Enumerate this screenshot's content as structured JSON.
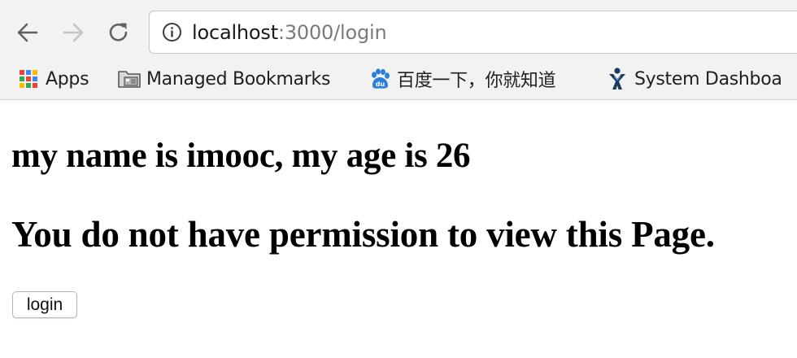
{
  "browser": {
    "url_host": "localhost",
    "url_rest": ":3000/login",
    "bookmarks": [
      {
        "label": "Apps",
        "icon": "apps-grid-icon"
      },
      {
        "label": "Managed Bookmarks",
        "icon": "folder-icon"
      },
      {
        "label": "百度一下，你就知道",
        "icon": "baidu-paw-icon"
      },
      {
        "label": "System Dashboa",
        "icon": "jira-icon"
      }
    ]
  },
  "page": {
    "heading_name": "my name is imooc, my age is 26",
    "heading_permission": "You do not have permission to view this Page.",
    "login_button": "login"
  },
  "colors": {
    "chrome_bg": "#f2f2f2",
    "url_host": "#1a1a1a",
    "url_rest": "#7a7a7a",
    "baidu_blue": "#2e7fdb",
    "jira_navy": "#1f3a5f"
  }
}
